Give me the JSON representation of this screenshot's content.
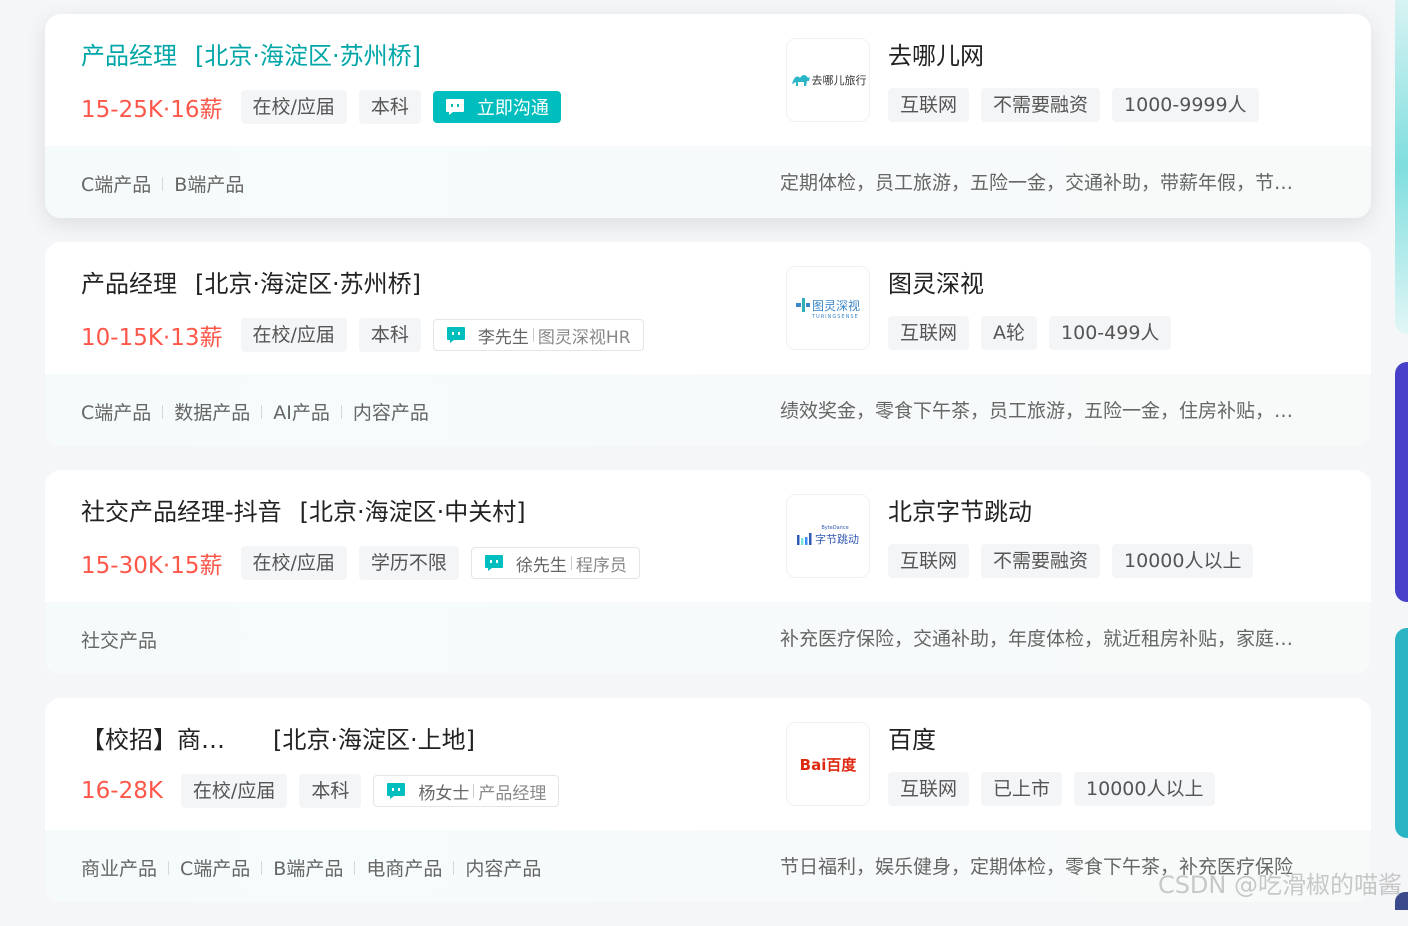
{
  "jobs": [
    {
      "title": "产品经理",
      "area": "[北京·海淀区·苏州桥]",
      "salary": "15-25K·16薪",
      "tags": [
        "在校/应届",
        "本科"
      ],
      "chat_label": "立即沟通",
      "company": {
        "name": "去哪儿网",
        "logo_text": "去哪儿旅行",
        "tags": [
          "互联网",
          "不需要融资",
          "1000-9999人"
        ]
      },
      "skills": [
        "C端产品",
        "B端产品"
      ],
      "welfare": "定期体检，员工旅游，五险一金，交通补助，带薪年假，节日福利"
    },
    {
      "title": "产品经理",
      "area": "[北京·海淀区·苏州桥]",
      "salary": "10-15K·13薪",
      "tags": [
        "在校/应届",
        "本科"
      ],
      "boss": {
        "name": "李先生",
        "title": "图灵深视HR"
      },
      "company": {
        "name": "图灵深视",
        "logo_text": "图灵深视",
        "logo_sub": "TURINGSENSE",
        "tags": [
          "互联网",
          "A轮",
          "100-499人"
        ]
      },
      "skills": [
        "C端产品",
        "数据产品",
        "AI产品",
        "内容产品"
      ],
      "welfare": "绩效奖金，零食下午茶，员工旅游，五险一金，住房补贴，定期体检"
    },
    {
      "title": "社交产品经理-抖音",
      "area": "[北京·海淀区·中关村]",
      "salary": "15-30K·15薪",
      "tags": [
        "在校/应届",
        "学历不限"
      ],
      "boss": {
        "name": "徐先生",
        "title": "程序员"
      },
      "company": {
        "name": "北京字节跳动",
        "logo_text": "字节跳动",
        "logo_sub": "ByteDance",
        "tags": [
          "互联网",
          "不需要融资",
          "10000人以上"
        ]
      },
      "skills": [
        "社交产品"
      ],
      "welfare": "补充医疗保险，交通补助，年度体检，就近租房补贴，家庭关怀"
    },
    {
      "title": "【校招】商业产品经理",
      "area": "[北京·海淀区·上地]",
      "salary": "16-28K",
      "tags": [
        "在校/应届",
        "本科"
      ],
      "boss": {
        "name": "杨女士",
        "title": "产品经理"
      },
      "company": {
        "name": "百度",
        "logo_text": "Bai百度",
        "tags": [
          "互联网",
          "已上市",
          "10000人以上"
        ]
      },
      "skills": [
        "商业产品",
        "C端产品",
        "B端产品",
        "电商产品",
        "内容产品"
      ],
      "welfare": "节日福利，娱乐健身，定期体检，零食下午茶，补充医疗保险"
    }
  ],
  "watermark": "CSDN @吃滑椒的喵酱",
  "colors": {
    "accent": "#00bebd",
    "salary": "#fe574a",
    "active_title": "#00a6a7"
  }
}
